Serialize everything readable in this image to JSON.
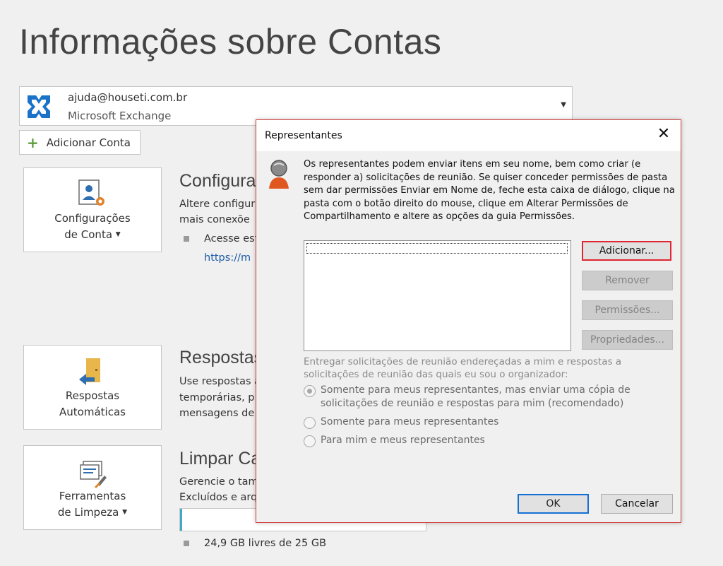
{
  "page": {
    "title": "Informações sobre Contas"
  },
  "account": {
    "email": "ajuda@houseti.com.br",
    "type": "Microsoft Exchange",
    "add_account_label": "Adicionar Conta"
  },
  "tiles": {
    "account_settings": {
      "line1": "Configurações",
      "line2": "de Conta"
    },
    "auto_replies": {
      "line1": "Respostas",
      "line2": "Automáticas"
    },
    "cleanup_tools": {
      "line1": "Ferramentas",
      "line2": "de Limpeza"
    }
  },
  "sections": {
    "settings": {
      "title": "Configura",
      "line1": "Altere configur",
      "line2": "mais conexõe",
      "bullet": "Acesse est",
      "link": "https://m"
    },
    "replies": {
      "title": "Respostas",
      "line1": "Use respostas a",
      "line2": "temporárias, p",
      "line3": "mensagens de"
    },
    "cleanup": {
      "title": "Limpar Ca",
      "line1": "Gerencie o tam",
      "line2": "Excluídos e arq",
      "storage_text": "24,9 GB livres de 25 GB",
      "storage_used_fraction": 0.004
    }
  },
  "dialog": {
    "title": "Representantes",
    "description": "Os representantes podem enviar itens em seu nome, bem como criar (e responder a) solicitações de reunião. Se quiser conceder permissões de pasta sem dar permissões Enviar em Nome de, feche esta caixa de diálogo, clique na pasta com o botão direito do mouse, clique em Alterar Permissões de Compartilhamento e altere as opções da guia Permissões.",
    "buttons": {
      "add": "Adicionar...",
      "remove": "Remover",
      "permissions": "Permissões...",
      "properties": "Propriedades...",
      "ok": "OK",
      "cancel": "Cancelar"
    },
    "deliver_label_line1": "Entregar solicitações de reunião endereçadas a mim e respostas a",
    "deliver_label_line2": "solicitações de reunião das quais eu sou o organizador:",
    "options": [
      {
        "line1": "Somente para meus representantes, mas enviar uma cópia de",
        "line2": "solicitações de reunião e respostas para mim (recomendado)",
        "selected": true
      },
      {
        "line1": "Somente para meus representantes",
        "selected": false
      },
      {
        "line1": "Para mim e meus representantes",
        "selected": false
      }
    ]
  },
  "colors": {
    "accent_red": "#e0262f",
    "focus_blue": "#1570d5",
    "link_blue": "#1b5aa6"
  }
}
